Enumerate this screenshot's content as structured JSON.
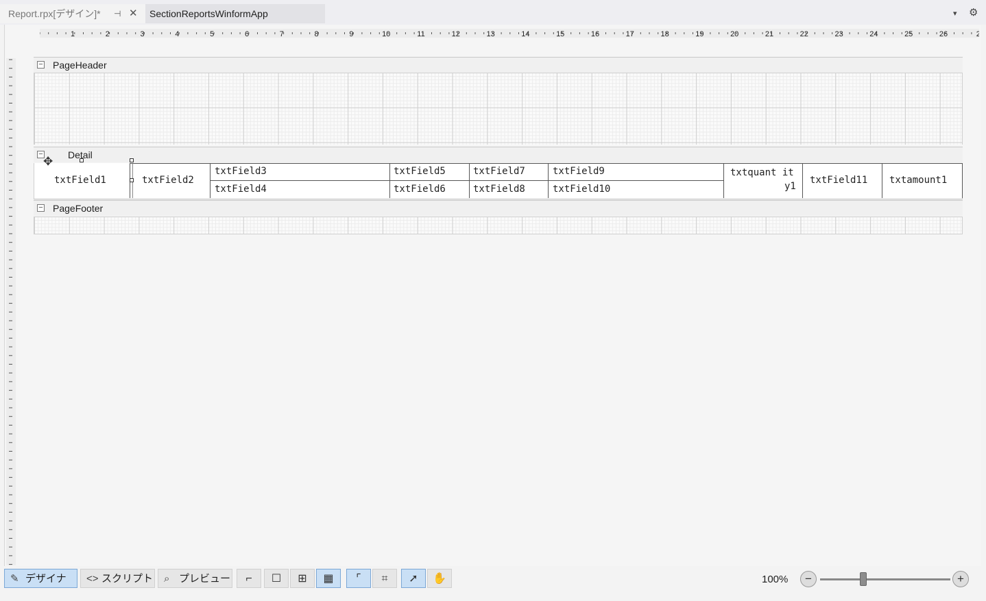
{
  "tabs": {
    "active": {
      "label": "Report.rpx[デザイン]*",
      "pin": "⊣",
      "close": "✕"
    },
    "other": {
      "label": "SectionReportsWinformApp"
    }
  },
  "icons": {
    "dropdown": "▾",
    "gear": "⚙"
  },
  "ruler": {
    "h_numbers": [
      "1",
      "2",
      "3",
      "4",
      "5",
      "6",
      "7",
      "8",
      "9",
      "10",
      "11",
      "12",
      "13",
      "14",
      "15",
      "16",
      "17",
      "18",
      "19",
      "20",
      "21",
      "22",
      "23",
      "24",
      "25",
      "26",
      "2"
    ]
  },
  "sections": {
    "page_header": {
      "label": "PageHeader"
    },
    "detail": {
      "label": "Detail"
    },
    "page_footer": {
      "label": "PageFooter"
    }
  },
  "fields": {
    "f1": "txtField1",
    "f2": "txtField2",
    "f3": "txtField3",
    "f4": "txtField4",
    "f5": "txtField5",
    "f6": "txtField6",
    "f7": "txtField7",
    "f8": "txtField8",
    "f9": "txtField9",
    "f10": "txtField10",
    "qty_line1": "txtquant it",
    "qty_line2": "y1",
    "f11": "txtField11",
    "amount": "txtamount1"
  },
  "bottom_toolbar": {
    "designer": "デザイナ",
    "script": "スクリプト",
    "preview": "プレビュー",
    "zoom": "100%",
    "zoom_minus": "−",
    "zoom_plus": "+",
    "zoom_level_percent": 100
  }
}
